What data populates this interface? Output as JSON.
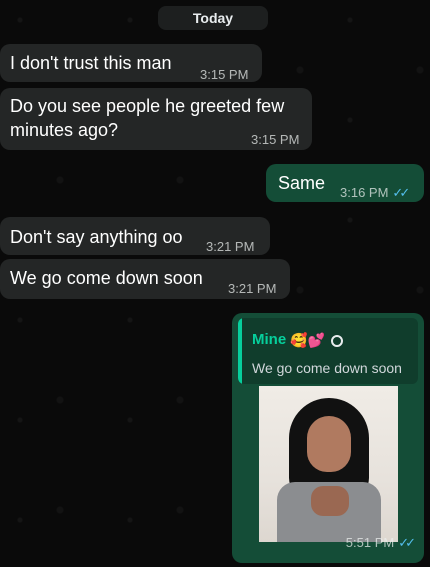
{
  "date_divider": "Today",
  "messages": [
    {
      "text": "I don't trust this man",
      "time": "3:15 PM"
    },
    {
      "text": "Do you see people he greeted few minutes ago?",
      "time": "3:15 PM"
    },
    {
      "text": "Same",
      "time": "3:16 PM",
      "status": "✓✓"
    },
    {
      "text": "Don't say anything oo",
      "time": "3:21 PM"
    },
    {
      "text": "We go come down soon",
      "time": "3:21 PM"
    },
    {
      "quoted_name": "Mine",
      "quoted_emojis": "🥰💕",
      "quoted_text": "We go come down soon",
      "time": "5:51 PM",
      "status": "✓✓"
    }
  ],
  "colors": {
    "incoming_bubble": "#242626",
    "outgoing_bubble": "#144d37",
    "read_ticks": "#53bdeb",
    "quote_accent": "#06cf9c"
  }
}
